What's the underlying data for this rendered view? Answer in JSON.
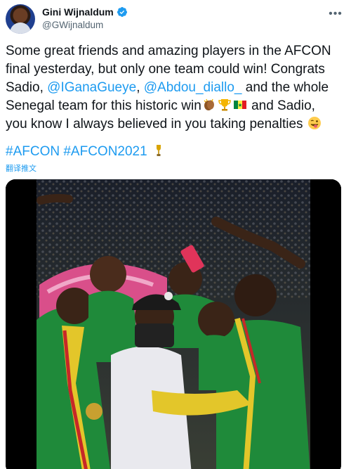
{
  "user": {
    "display_name": "Gini Wijnaldum",
    "handle": "@GWijnaldum"
  },
  "tweet": {
    "line1": "Some great friends and amazing players in the AFCON",
    "line2": "final yesterday, but only one team could win! Congrats",
    "line3_pre": "Sadio, ",
    "mention1": "@IGanaGueye",
    "line3_sep": ", ",
    "mention2": "@Abdou_diallo_",
    "line3_post": " and the whole",
    "line4_pre": "Senegal team for this historic win",
    "line4_post": " and Sadio,",
    "line5": "you know I always believed in you taking penalties",
    "hashtag1": "#AFCON",
    "hashtag2": "#AFCON2021",
    "translate_label": "翻译推文"
  },
  "icons": {
    "verified": "verified-badge-icon",
    "more": "more-options-icon",
    "clap": "clapping-hands-emoji",
    "trophy": "trophy-emoji",
    "flag": "senegal-flag-emoji",
    "wink": "winking-face-tongue-emoji",
    "trophy_small": "trophy-emoji"
  },
  "colors": {
    "accent": "#1d9bf0",
    "text": "#0f1419",
    "muted": "#536471"
  }
}
